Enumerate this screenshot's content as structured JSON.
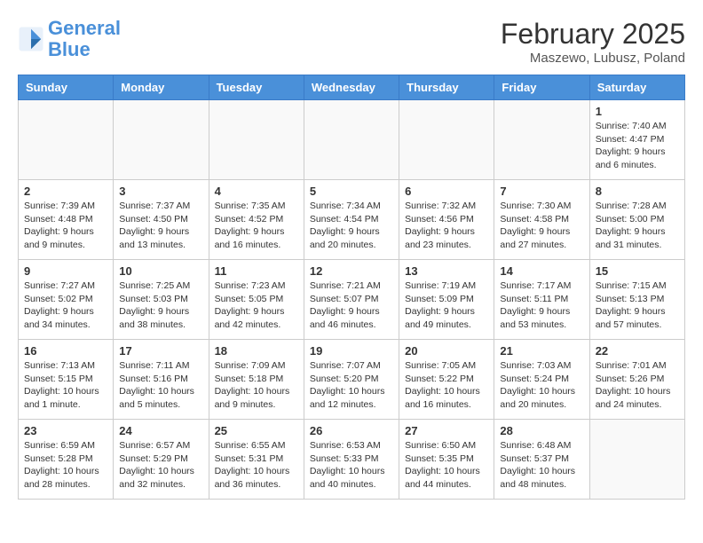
{
  "header": {
    "logo_line1": "General",
    "logo_line2": "Blue",
    "month_title": "February 2025",
    "subtitle": "Maszewo, Lubusz, Poland"
  },
  "weekdays": [
    "Sunday",
    "Monday",
    "Tuesday",
    "Wednesday",
    "Thursday",
    "Friday",
    "Saturday"
  ],
  "weeks": [
    [
      {
        "day": "",
        "info": ""
      },
      {
        "day": "",
        "info": ""
      },
      {
        "day": "",
        "info": ""
      },
      {
        "day": "",
        "info": ""
      },
      {
        "day": "",
        "info": ""
      },
      {
        "day": "",
        "info": ""
      },
      {
        "day": "1",
        "info": "Sunrise: 7:40 AM\nSunset: 4:47 PM\nDaylight: 9 hours and 6 minutes."
      }
    ],
    [
      {
        "day": "2",
        "info": "Sunrise: 7:39 AM\nSunset: 4:48 PM\nDaylight: 9 hours and 9 minutes."
      },
      {
        "day": "3",
        "info": "Sunrise: 7:37 AM\nSunset: 4:50 PM\nDaylight: 9 hours and 13 minutes."
      },
      {
        "day": "4",
        "info": "Sunrise: 7:35 AM\nSunset: 4:52 PM\nDaylight: 9 hours and 16 minutes."
      },
      {
        "day": "5",
        "info": "Sunrise: 7:34 AM\nSunset: 4:54 PM\nDaylight: 9 hours and 20 minutes."
      },
      {
        "day": "6",
        "info": "Sunrise: 7:32 AM\nSunset: 4:56 PM\nDaylight: 9 hours and 23 minutes."
      },
      {
        "day": "7",
        "info": "Sunrise: 7:30 AM\nSunset: 4:58 PM\nDaylight: 9 hours and 27 minutes."
      },
      {
        "day": "8",
        "info": "Sunrise: 7:28 AM\nSunset: 5:00 PM\nDaylight: 9 hours and 31 minutes."
      }
    ],
    [
      {
        "day": "9",
        "info": "Sunrise: 7:27 AM\nSunset: 5:02 PM\nDaylight: 9 hours and 34 minutes."
      },
      {
        "day": "10",
        "info": "Sunrise: 7:25 AM\nSunset: 5:03 PM\nDaylight: 9 hours and 38 minutes."
      },
      {
        "day": "11",
        "info": "Sunrise: 7:23 AM\nSunset: 5:05 PM\nDaylight: 9 hours and 42 minutes."
      },
      {
        "day": "12",
        "info": "Sunrise: 7:21 AM\nSunset: 5:07 PM\nDaylight: 9 hours and 46 minutes."
      },
      {
        "day": "13",
        "info": "Sunrise: 7:19 AM\nSunset: 5:09 PM\nDaylight: 9 hours and 49 minutes."
      },
      {
        "day": "14",
        "info": "Sunrise: 7:17 AM\nSunset: 5:11 PM\nDaylight: 9 hours and 53 minutes."
      },
      {
        "day": "15",
        "info": "Sunrise: 7:15 AM\nSunset: 5:13 PM\nDaylight: 9 hours and 57 minutes."
      }
    ],
    [
      {
        "day": "16",
        "info": "Sunrise: 7:13 AM\nSunset: 5:15 PM\nDaylight: 10 hours and 1 minute."
      },
      {
        "day": "17",
        "info": "Sunrise: 7:11 AM\nSunset: 5:16 PM\nDaylight: 10 hours and 5 minutes."
      },
      {
        "day": "18",
        "info": "Sunrise: 7:09 AM\nSunset: 5:18 PM\nDaylight: 10 hours and 9 minutes."
      },
      {
        "day": "19",
        "info": "Sunrise: 7:07 AM\nSunset: 5:20 PM\nDaylight: 10 hours and 12 minutes."
      },
      {
        "day": "20",
        "info": "Sunrise: 7:05 AM\nSunset: 5:22 PM\nDaylight: 10 hours and 16 minutes."
      },
      {
        "day": "21",
        "info": "Sunrise: 7:03 AM\nSunset: 5:24 PM\nDaylight: 10 hours and 20 minutes."
      },
      {
        "day": "22",
        "info": "Sunrise: 7:01 AM\nSunset: 5:26 PM\nDaylight: 10 hours and 24 minutes."
      }
    ],
    [
      {
        "day": "23",
        "info": "Sunrise: 6:59 AM\nSunset: 5:28 PM\nDaylight: 10 hours and 28 minutes."
      },
      {
        "day": "24",
        "info": "Sunrise: 6:57 AM\nSunset: 5:29 PM\nDaylight: 10 hours and 32 minutes."
      },
      {
        "day": "25",
        "info": "Sunrise: 6:55 AM\nSunset: 5:31 PM\nDaylight: 10 hours and 36 minutes."
      },
      {
        "day": "26",
        "info": "Sunrise: 6:53 AM\nSunset: 5:33 PM\nDaylight: 10 hours and 40 minutes."
      },
      {
        "day": "27",
        "info": "Sunrise: 6:50 AM\nSunset: 5:35 PM\nDaylight: 10 hours and 44 minutes."
      },
      {
        "day": "28",
        "info": "Sunrise: 6:48 AM\nSunset: 5:37 PM\nDaylight: 10 hours and 48 minutes."
      },
      {
        "day": "",
        "info": ""
      }
    ]
  ]
}
